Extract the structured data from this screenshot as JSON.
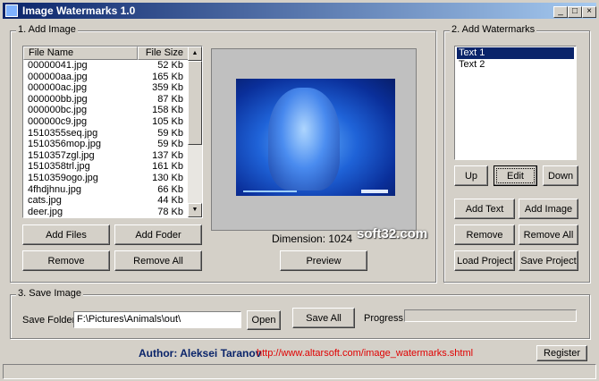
{
  "window": {
    "title": "Image Watermarks 1.0",
    "controls": {
      "minimize": "_",
      "maximize": "□",
      "close": "×"
    }
  },
  "add_image": {
    "legend": "1. Add Image",
    "columns": {
      "name": "File Name",
      "size": "File Size"
    },
    "files": [
      {
        "name": "00000041.jpg",
        "size": "52 Kb"
      },
      {
        "name": "000000aa.jpg",
        "size": "165 Kb"
      },
      {
        "name": "000000ac.jpg",
        "size": "359 Kb"
      },
      {
        "name": "000000bb.jpg",
        "size": "87 Kb"
      },
      {
        "name": "000000bc.jpg",
        "size": "158 Kb"
      },
      {
        "name": "000000c9.jpg",
        "size": "105 Kb"
      },
      {
        "name": "1510355seq.jpg",
        "size": "59 Kb"
      },
      {
        "name": "1510356mop.jpg",
        "size": "59 Kb"
      },
      {
        "name": "1510357zgl.jpg",
        "size": "137 Kb"
      },
      {
        "name": "1510358trl.jpg",
        "size": "161 Kb"
      },
      {
        "name": "1510359ogo.jpg",
        "size": "130 Kb"
      },
      {
        "name": "4fhdjhnu.jpg",
        "size": "66 Kb"
      },
      {
        "name": "cats.jpg",
        "size": "44 Kb"
      },
      {
        "name": "deer.jpg",
        "size": "78 Kb"
      }
    ],
    "buttons": {
      "add_files": "Add Files",
      "add_folder": "Add Foder",
      "remove": "Remove",
      "remove_all": "Remove All"
    },
    "dimension": "Dimension: 1024",
    "preview_button": "Preview",
    "watermark_logo": "soft32.com"
  },
  "add_watermarks": {
    "legend": "2. Add Watermarks",
    "items": [
      "Text 1",
      "Text 2"
    ],
    "selected_index": 0,
    "buttons": {
      "up": "Up",
      "edit": "Edit",
      "down": "Down",
      "add_text": "Add Text",
      "add_image": "Add Image",
      "remove": "Remove",
      "remove_all": "Remove All",
      "load_project": "Load Project",
      "save_project": "Save Project"
    }
  },
  "save_image": {
    "legend": "3. Save Image",
    "folder_label": "Save Folder:",
    "folder_value": "F:\\Pictures\\Animals\\out\\",
    "open_button": "Open",
    "save_all_button": "Save All",
    "progress_label": "Progress:",
    "progress": 0
  },
  "footer": {
    "author": "Author: Aleksei Taranov",
    "url": "http://www.altarsoft.com/image_watermarks.shtml",
    "register_button": "Register"
  }
}
